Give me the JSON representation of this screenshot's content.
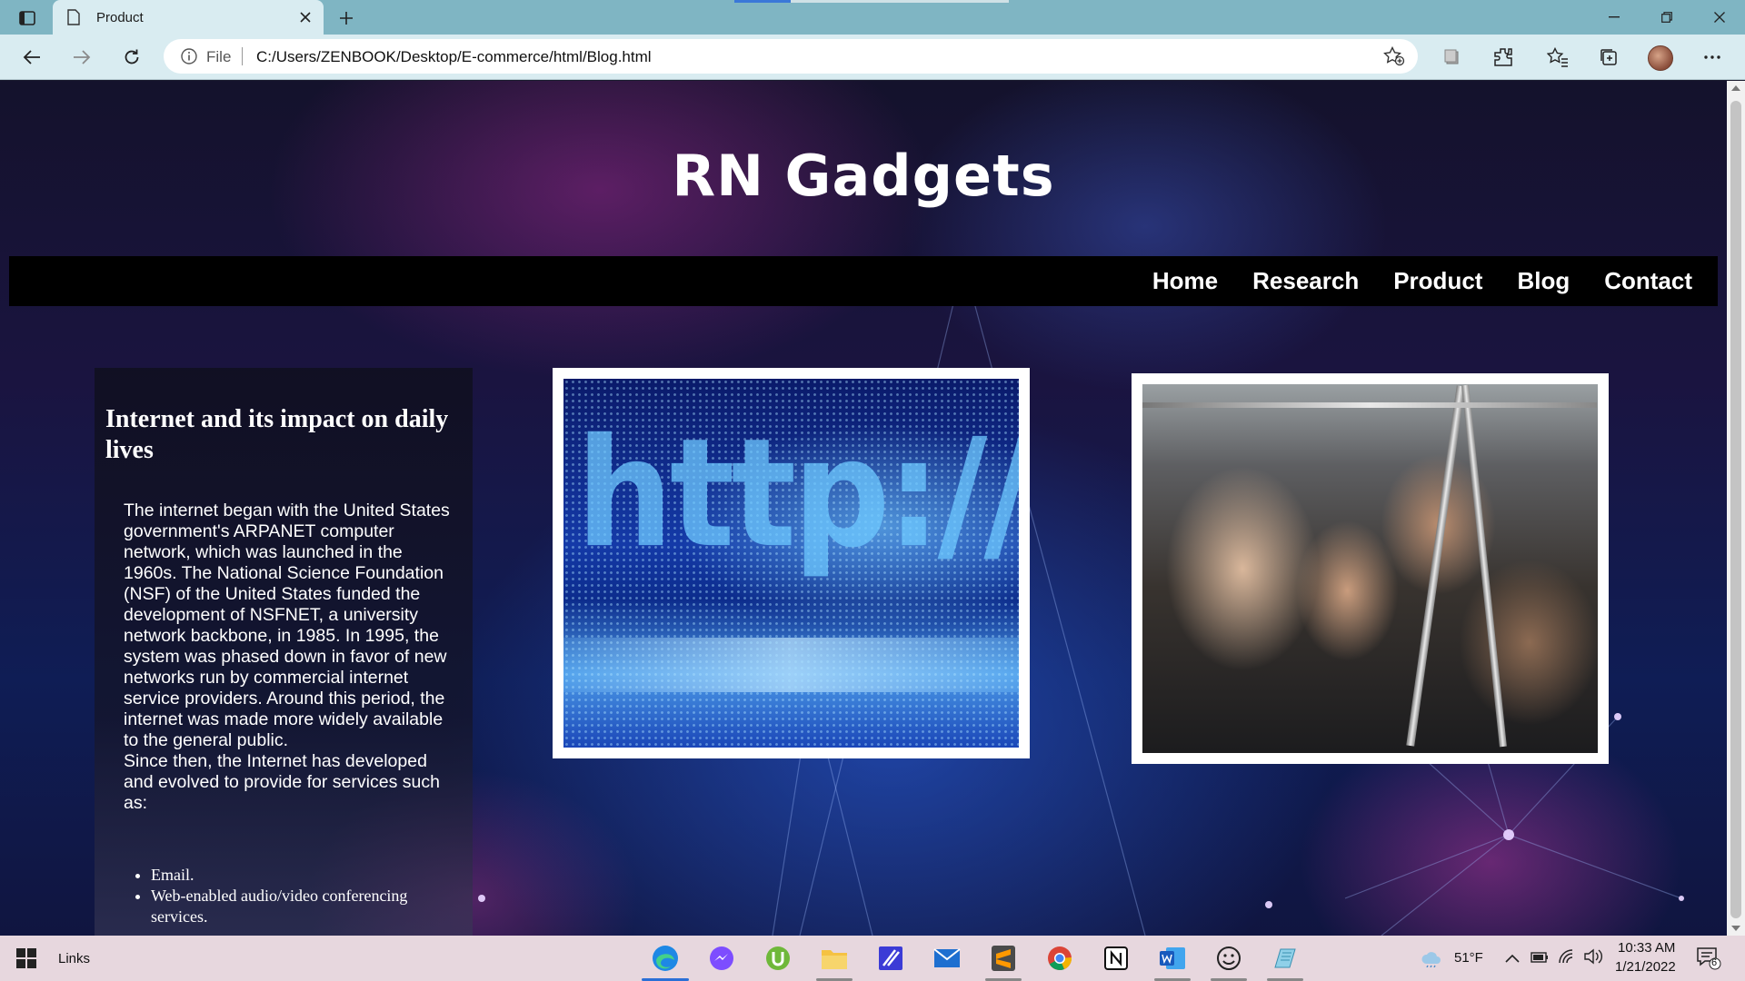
{
  "browser": {
    "tab_title": "Product",
    "address_prefix": "File",
    "url": "C:/Users/ZENBOOK/Desktop/E-commerce/html/Blog.html"
  },
  "site": {
    "title": "RN Gadgets",
    "nav": [
      "Home",
      "Research",
      "Product",
      "Blog",
      "Contact"
    ]
  },
  "article": {
    "heading": "Internet and its impact on daily lives",
    "paragraphs": [
      "The internet began with the United States government's ARPANET computer network, which was launched in the 1960s. The National Science Foundation (NSF) of the United States funded the development of NSFNET, a university network backbone, in 1985. In 1995, the system was phased down in favor of new networks run by commercial internet service providers. Around this period, the internet was made more widely available to the general public.",
      "Since then, the Internet has developed and evolved to provide for services such as:"
    ],
    "list": [
      "Email.",
      "Web-enabled audio/video conferencing services."
    ]
  },
  "images": {
    "http_text": "http://www."
  },
  "taskbar": {
    "links_label": "Links",
    "apps": [
      "edge-icon",
      "messenger-icon",
      "utorrent-icon",
      "file-explorer-icon",
      "editor-icon",
      "mail-icon",
      "sublime-icon",
      "chrome-icon",
      "notion-icon",
      "word-icon",
      "emoji-icon",
      "notepad-icon"
    ],
    "weather": "51°F",
    "time": "10:33 AM",
    "date": "1/21/2022",
    "notifications": "6"
  }
}
